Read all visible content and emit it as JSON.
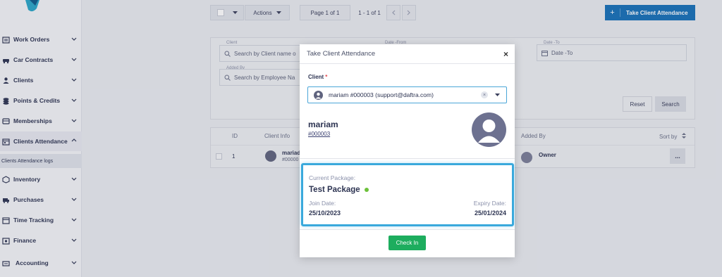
{
  "sidebar": {
    "items": [
      {
        "label": "Work Orders",
        "icon": "work-orders-icon"
      },
      {
        "label": "Car Contracts",
        "icon": "car-icon"
      },
      {
        "label": "Clients",
        "icon": "clients-icon"
      },
      {
        "label": "Points & Credits",
        "icon": "points-icon"
      },
      {
        "label": "Memberships",
        "icon": "memberships-icon"
      },
      {
        "label": "Clients Attendance",
        "icon": "attendance-icon"
      },
      {
        "label": "Inventory",
        "icon": "inventory-icon"
      },
      {
        "label": "Purchases",
        "icon": "purchases-icon"
      },
      {
        "label": "Time Tracking",
        "icon": "time-icon"
      },
      {
        "label": "Finance",
        "icon": "finance-icon"
      },
      {
        "label": "Accounting",
        "icon": "accounting-icon"
      }
    ],
    "subitem": "Clients Attendance logs"
  },
  "toolbar": {
    "actions_label": "Actions",
    "page_label": "Page 1 of 1",
    "range_label": "1 - 1 of 1",
    "primary_label": "Take Client Attendance",
    "primary_plus": "+"
  },
  "filter": {
    "client_label": "Client",
    "client_placeholder": "Search by Client name o",
    "date_from_label": "Date -From",
    "date_to_label": "Date -To",
    "date_to_placeholder": "Date -To",
    "added_by_label": "Added By",
    "added_by_placeholder": "Search by Employee Na",
    "reset_label": "Reset",
    "search_label": "Search"
  },
  "table": {
    "headers": {
      "id": "ID",
      "client_info": "Client Info",
      "added_by": "Added By",
      "sort_by": "Sort by"
    },
    "row": {
      "id": "1",
      "client_name": "mariad",
      "client_num": "#00000",
      "added_by": "Owner",
      "more": "..."
    }
  },
  "modal": {
    "title": "Take Client Attendance",
    "close": "×",
    "client_label": "Client",
    "required_mark": "*",
    "selected_client": "mariam #000003 (support@daftra.com)",
    "client_name": "mariam",
    "client_number": "#000003",
    "package": {
      "current_label": "Current Package:",
      "name": "Test Package",
      "join_label": "Join Date:",
      "join_date": "25/10/2023",
      "expiry_label": "Expiry Date:",
      "expiry_date": "25/01/2024",
      "status_color": "#6cc13a"
    },
    "checkin_label": "Check In"
  },
  "colors": {
    "primary": "#1670b8",
    "success": "#1dad5e",
    "highlight": "#3aa9dc"
  }
}
